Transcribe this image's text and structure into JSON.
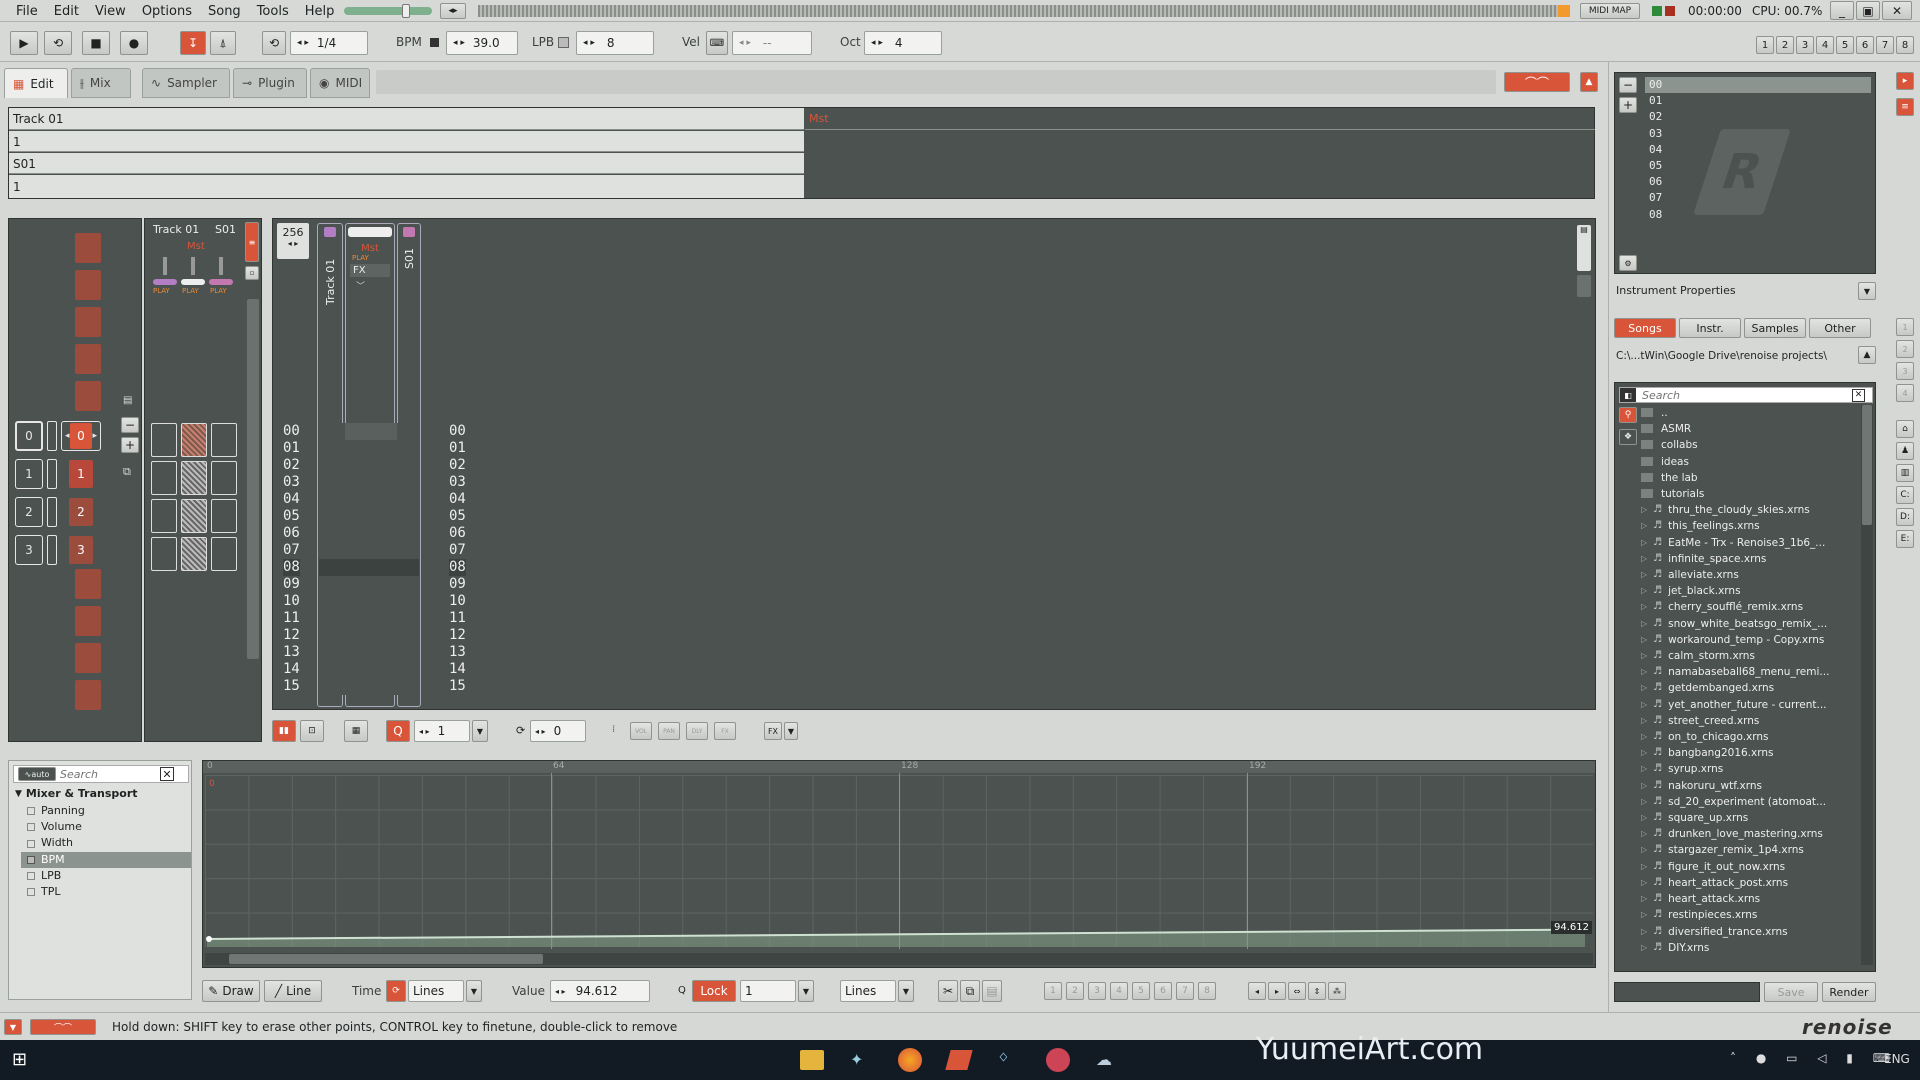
{
  "menu": [
    "File",
    "Edit",
    "View",
    "Options",
    "Song",
    "Tools",
    "Help"
  ],
  "top": {
    "midi_map": "MIDI MAP",
    "time": "00:00:00",
    "cpu": "CPU: 00.7%"
  },
  "toolbar": {
    "pattern_step": "1/4",
    "bpm_label": "BPM",
    "bpm": "39.0",
    "lpb_label": "LPB",
    "lpb": "8",
    "vel_label": "Vel",
    "vel": "--",
    "oct_label": "Oct",
    "oct": "4",
    "right_nums": [
      "1",
      "2",
      "3",
      "4",
      "5",
      "6",
      "7",
      "8"
    ]
  },
  "tabs": [
    {
      "label": "Edit"
    },
    {
      "label": "Mix"
    },
    {
      "label": "Sampler"
    },
    {
      "label": "Plugin"
    },
    {
      "label": "MIDI"
    }
  ],
  "song_rows": {
    "track": "Track 01",
    "mst": "Mst",
    "row1": "1",
    "send": "S01",
    "row3": "1"
  },
  "matrix": {
    "seq": [
      "0",
      "1",
      "2",
      "3"
    ],
    "pat": [
      "0",
      "1",
      "2",
      "3"
    ]
  },
  "mixer": {
    "track": "Track 01",
    "send": "S01",
    "mst": "Mst",
    "play": "PLAY"
  },
  "pattern": {
    "lines": "256",
    "col_track": "Track 01",
    "col_mst": "Mst",
    "col_send": "S01",
    "fx": "FX",
    "play": "PLAY",
    "rows": [
      "00",
      "01",
      "02",
      "03",
      "04",
      "05",
      "06",
      "07",
      "08",
      "09",
      "10",
      "11",
      "12",
      "13",
      "14",
      "15"
    ]
  },
  "pattern_bar": {
    "step": "1",
    "edit_step": "0",
    "vol": "VOL",
    "pan": "PAN",
    "dly": "DLY",
    "fx": "FX"
  },
  "automation": {
    "search_placeholder": "Search",
    "group": "Mixer & Transport",
    "params": [
      "Panning",
      "Volume",
      "Width",
      "BPM",
      "LPB",
      "TPL"
    ],
    "ruler": [
      "0",
      "64",
      "128",
      "192"
    ],
    "start_value": "0",
    "end_value": "94.612",
    "level": 0.06
  },
  "auto_bar": {
    "draw": "Draw",
    "line": "Line",
    "time": "Time",
    "lines": "Lines",
    "value_label": "Value",
    "value": "94.612",
    "lock": "Lock",
    "q_val": "1",
    "lines2": "Lines",
    "nums": [
      "1",
      "2",
      "3",
      "4",
      "5",
      "6",
      "7",
      "8"
    ]
  },
  "instruments": {
    "slots": [
      "00",
      "01",
      "02",
      "03",
      "04",
      "05",
      "06",
      "07",
      "08"
    ],
    "props": "Instrument Properties"
  },
  "browser": {
    "tabs": [
      "Songs",
      "Instr.",
      "Samples",
      "Other"
    ],
    "path": "C:\\...tWin\\Google Drive\\renoise projects\\",
    "search_placeholder": "Search",
    "folders": [
      "..",
      "ASMR",
      "collabs",
      "ideas",
      "the lab",
      "tutorials"
    ],
    "files": [
      "thru_the_cloudy_skies.xrns",
      "this_feelings.xrns",
      "EatMe - Trx - Renoise3_1b6_...",
      "infinite_space.xrns",
      "alleviate.xrns",
      "jet_black.xrns",
      "cherry_soufflé_remix.xrns",
      "snow_white_beatsgo_remix_...",
      "workaround_temp - Copy.xrns",
      "calm_storm.xrns",
      "namabaseball68_menu_remi...",
      "getdembanged.xrns",
      "yet_another_future - current...",
      "street_creed.xrns",
      "on_to_chicago.xrns",
      "bangbang2016.xrns",
      "syrup.xrns",
      "nakoruru_wtf.xrns",
      "sd_20_experiment (atomoat...",
      "square_up.xrns",
      "drunken_love_mastering.xrns",
      "stargazer_remix_1p4.xrns",
      "figure_it_out_now.xrns",
      "heart_attack_post.xrns",
      "heart_attack.xrns",
      "restinpieces.xrns",
      "diversified_trance.xrns",
      "DIY.xrns"
    ],
    "save": "Save",
    "render": "Render"
  },
  "status": {
    "message": "Hold down: SHIFT key to erase other points, CONTROL key to finetune, double-click to remove",
    "brand": "renoise"
  },
  "taskbar": {
    "watermark": "YuumeiArt.com",
    "lang": "ENG"
  },
  "colors": {
    "accent": "#d9553a",
    "panel": "#4b5250",
    "light": "#d6d8d5"
  }
}
